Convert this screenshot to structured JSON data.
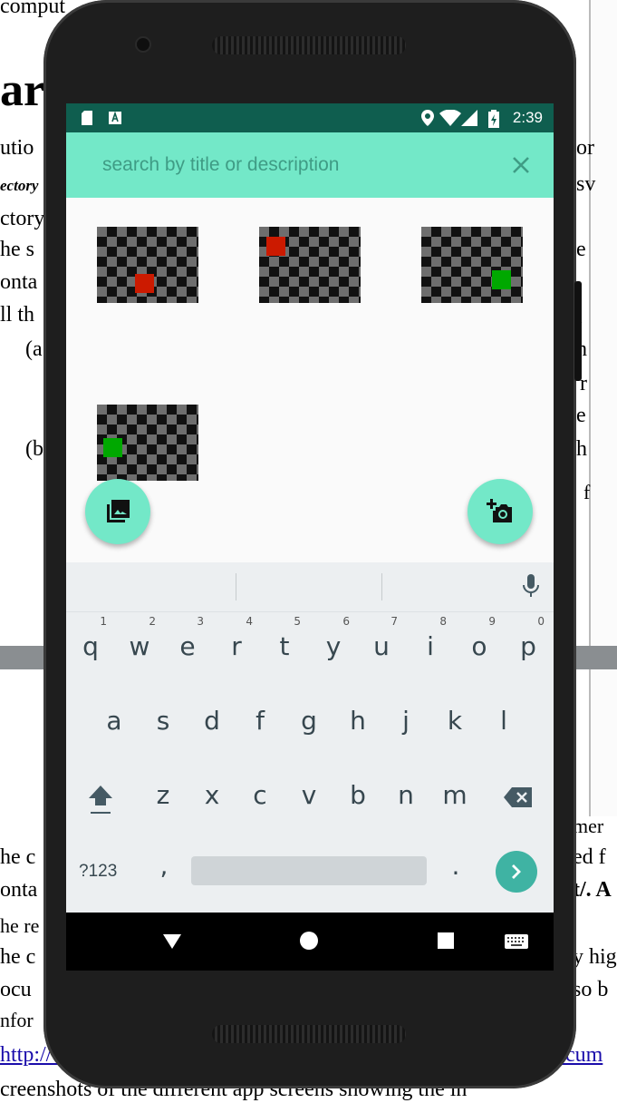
{
  "background_text": {
    "left": [
      "comput",
      "ar",
      "utio",
      "ectory",
      "ctory",
      "he s",
      "onta",
      "ll th",
      "(a",
      "(b",
      "he c",
      "onta",
      "he re",
      "he c",
      "ocu",
      "nfor",
      "http://v"
    ],
    "right": [
      "or",
      "sv",
      "e",
      "i",
      "h",
      "r",
      "e",
      "h",
      "f",
      "mer",
      "ed f",
      "t/. A",
      "y hig",
      "so b",
      "ocum"
    ],
    "bottom_line": "creenshots of the different app screens showing the in"
  },
  "status_bar": {
    "time": "2:39",
    "left_icons": [
      "sd-card-icon",
      "a-notification-icon"
    ],
    "right_icons": [
      "location-icon",
      "wifi-icon",
      "signal-icon",
      "battery-charging-icon"
    ]
  },
  "search": {
    "placeholder": "search by title or description",
    "value": "",
    "clear_icon": "close-icon"
  },
  "gallery": {
    "items": [
      {
        "dot_color": "#cc1a00"
      },
      {
        "dot_color": "#cc1a00"
      },
      {
        "dot_color": "#00a800"
      },
      {
        "dot_color": "#00a800"
      }
    ]
  },
  "fabs": {
    "gallery_icon": "photo-library-icon",
    "camera_icon": "add-a-photo-icon"
  },
  "keyboard": {
    "row1": [
      "q",
      "w",
      "e",
      "r",
      "t",
      "y",
      "u",
      "i",
      "o",
      "p"
    ],
    "row1_numbers": [
      "1",
      "2",
      "3",
      "4",
      "5",
      "6",
      "7",
      "8",
      "9",
      "0"
    ],
    "row2": [
      "a",
      "s",
      "d",
      "f",
      "g",
      "h",
      "j",
      "k",
      "l"
    ],
    "row3": [
      "z",
      "x",
      "c",
      "v",
      "b",
      "n",
      "m"
    ],
    "symbols_label": "?123",
    "comma": ",",
    "period": ".",
    "mic_icon": "mic-icon",
    "shift_icon": "shift-icon",
    "backspace_icon": "backspace-icon",
    "go_icon": "arrow-right-icon"
  },
  "colors": {
    "status_bar": "#0f5e4f",
    "accent": "#73e8c8",
    "keyboard_bg": "#eceff1",
    "go_button": "#3fb3a3"
  }
}
